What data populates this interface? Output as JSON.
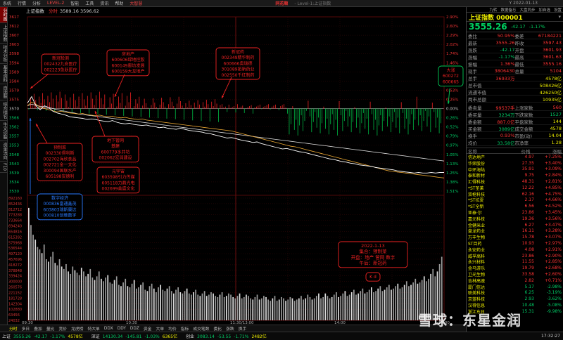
{
  "menubar": {
    "items": [
      "系统",
      "行情",
      "分析",
      "LEVEL-2",
      "智能",
      "工具",
      "资讯",
      "帮助",
      "大智慧"
    ],
    "logo": "同花顺",
    "level": "- Level-1:上证指数",
    "right": "Y 2022-01-13"
  },
  "leftbar": [
    "分时图",
    "上证指数",
    "技术分析",
    "基本资料",
    "自选股",
    "综合排名",
    "牛叉诊股",
    "资金流向",
    "F10"
  ],
  "chart": {
    "header_name": "上证指数",
    "header_freq": "分时",
    "header_vals": "3589.16  3596.62",
    "yaxis_left": [
      "3617",
      "3612",
      "3607",
      "3603",
      "3598",
      "3594",
      "3589",
      "3584",
      "3579",
      "3575",
      "3570",
      "3566",
      "3562",
      "3557",
      "3553",
      "3548",
      "3543",
      "3539",
      "3534",
      "3530"
    ],
    "yaxis_right": [
      "2.90%",
      "2.60%",
      "2.29%",
      "2.02%",
      "1.74%",
      "1.46%",
      "1.18%",
      "0.87%",
      "0.53%",
      "0.25%",
      "0.00%",
      "0.26%",
      "0.52%",
      "0.79%",
      "0.97%",
      "1.05%",
      "1.13%",
      "1.25%",
      "1.38%",
      "1.51%"
    ],
    "vol_axis": [
      "892160",
      "852436",
      "812712",
      "773288",
      "733664",
      "694240",
      "654816",
      "615392",
      "575968",
      "536544",
      "497120",
      "457696",
      "418272",
      "378848",
      "339424",
      "300000",
      "260576",
      "221152",
      "181728",
      "142304",
      "102880",
      "63456",
      "24032"
    ],
    "time_axis": [
      "09:30",
      "10:30",
      "11:30/13:00",
      "14:00",
      "15:00"
    ],
    "vol_values": [
      92,
      78,
      70,
      66,
      60,
      58,
      55,
      62,
      50,
      48,
      52,
      56,
      47,
      45,
      50,
      44,
      42,
      46,
      40,
      38,
      44,
      41,
      39,
      37,
      43,
      40,
      36,
      38,
      42,
      35,
      33,
      36,
      40,
      34,
      32,
      35,
      37,
      31,
      30,
      33,
      36,
      29,
      28,
      31,
      34,
      28,
      27,
      30,
      33,
      26,
      27,
      29,
      31,
      25,
      24,
      28,
      30,
      26,
      23,
      27,
      29,
      25,
      24,
      26,
      28,
      24,
      22,
      25,
      27,
      23,
      22,
      24,
      26,
      22,
      21,
      23,
      25,
      21,
      20,
      22,
      24,
      20,
      21,
      23,
      22,
      20,
      19,
      21,
      23,
      19,
      20,
      22,
      21,
      19,
      18,
      20,
      22,
      18,
      19,
      21,
      20,
      18,
      17,
      19,
      21,
      17,
      18,
      20,
      19,
      17,
      16,
      18,
      20,
      16,
      17,
      19,
      18,
      16,
      17,
      19,
      18,
      16,
      17,
      18,
      20,
      17,
      18,
      21,
      19,
      17,
      18,
      20,
      22,
      18,
      19,
      22,
      20,
      18,
      19,
      21,
      23,
      19,
      20,
      22,
      24,
      20,
      21,
      23,
      25,
      21,
      22,
      24,
      26,
      22,
      23,
      25,
      27,
      23,
      24,
      26,
      28,
      24,
      25,
      27,
      29,
      25,
      26,
      28,
      30,
      26,
      27,
      29,
      32,
      28,
      29,
      31,
      34,
      30,
      31,
      33,
      36,
      32,
      34,
      38,
      42,
      36,
      40,
      46,
      52
    ],
    "price_line": [
      0.1,
      0.22,
      0.05,
      -0.02,
      0.05,
      0.02,
      -0.05,
      -0.08,
      -0.1,
      -0.12,
      -0.15,
      -0.16,
      -0.17,
      -0.18,
      -0.2,
      -0.19,
      -0.2,
      -0.22,
      -0.23,
      -0.24,
      -0.22,
      -0.25,
      -0.27,
      -0.28,
      -0.27,
      -0.29,
      -0.3,
      -0.31,
      -0.3,
      -0.32,
      -0.33,
      -0.35,
      -0.34,
      -0.36,
      -0.37,
      -0.38,
      -0.36,
      -0.38,
      -0.4,
      -0.41,
      -0.42,
      -0.43,
      -0.45,
      -0.46,
      -0.48,
      -0.5,
      -0.52,
      -0.54,
      -0.53,
      -0.55,
      -0.57,
      -0.59,
      -0.6,
      -0.62,
      -0.61,
      -0.64,
      -0.66,
      -0.68,
      -0.7,
      -0.72,
      -0.74,
      -0.73,
      -0.75,
      -0.77,
      -0.79,
      -0.8,
      -0.82,
      -0.84,
      -0.86,
      -0.88,
      -0.9,
      -0.92,
      -0.93,
      -0.95,
      -0.97,
      -0.98,
      -1.0,
      -1.01,
      -1.03,
      -1.04,
      -1.05,
      -1.06,
      -1.08,
      -1.09,
      -1.1,
      -1.11,
      -1.12,
      -1.14,
      -1.15,
      -1.16,
      -1.17,
      -1.18,
      -1.17,
      -1.18,
      -1.18,
      -1.17,
      -1.18,
      -1.17,
      -1.17
    ],
    "avg_line": [
      0.05,
      0.08,
      0.06,
      0.04,
      0.03,
      0.02,
      0.0,
      -0.02,
      -0.04,
      -0.05,
      -0.07,
      -0.08,
      -0.1,
      -0.11,
      -0.12,
      -0.13,
      -0.14,
      -0.15,
      -0.16,
      -0.17,
      -0.18,
      -0.19,
      -0.2,
      -0.21,
      -0.22,
      -0.23,
      -0.24,
      -0.25,
      -0.26,
      -0.27,
      -0.28,
      -0.29,
      -0.3,
      -0.31,
      -0.32,
      -0.33,
      -0.34,
      -0.35,
      -0.36,
      -0.37,
      -0.38,
      -0.39,
      -0.4,
      -0.41,
      -0.42,
      -0.43,
      -0.44,
      -0.45,
      -0.46,
      -0.47,
      -0.48,
      -0.49,
      -0.5,
      -0.51,
      -0.52,
      -0.53,
      -0.54,
      -0.55,
      -0.56,
      -0.57,
      -0.58,
      -0.59,
      -0.6,
      -0.61,
      -0.62,
      -0.63,
      -0.64,
      -0.65,
      -0.66,
      -0.67,
      -0.68,
      -0.69,
      -0.7,
      -0.71,
      -0.72,
      -0.73,
      -0.74,
      -0.75,
      -0.76,
      -0.77,
      -0.78,
      -0.79,
      -0.8,
      -0.81,
      -0.82,
      -0.83,
      -0.84,
      -0.85,
      -0.86,
      -0.87,
      -0.88,
      -0.89,
      -0.9,
      -0.91,
      -0.92,
      -0.93,
      -0.94,
      -0.95,
      -0.96
    ],
    "yellow_line": [
      0.05,
      0.12,
      0.08,
      0.02,
      0.0,
      -0.02,
      -0.04,
      -0.06,
      -0.05,
      -0.07,
      -0.08,
      -0.09,
      -0.1,
      -0.09,
      -0.11,
      -0.12,
      -0.13,
      -0.12,
      -0.14,
      -0.15,
      -0.14,
      -0.16,
      -0.17,
      -0.16,
      -0.18,
      -0.19,
      -0.2,
      -0.19,
      -0.21,
      -0.22,
      -0.23,
      -0.24,
      -0.25,
      -0.26,
      -0.27,
      -0.28,
      -0.29,
      -0.3,
      -0.31,
      -0.32,
      -0.33,
      -0.34,
      -0.35,
      -0.36,
      -0.37,
      -0.38,
      -0.39,
      -0.4,
      -0.41,
      -0.43,
      -0.45,
      -0.47,
      -0.49,
      -0.51,
      -0.53,
      -0.55,
      -0.57,
      -0.59,
      -0.61,
      -0.63,
      -0.65,
      -0.67,
      -0.69,
      -0.7,
      -0.72,
      -0.74,
      -0.76,
      -0.78,
      -0.8,
      -0.82,
      -0.84,
      -0.86,
      -0.88,
      -0.9,
      -0.92,
      -0.94,
      -0.96,
      -0.98,
      -1.0,
      -1.02,
      -1.04,
      -1.06,
      -1.08,
      -1.1,
      -1.12,
      -1.14,
      -1.15,
      -1.16,
      -1.17,
      -1.18,
      -1.19,
      -1.2,
      -1.21,
      -1.22,
      -1.23,
      -1.24,
      -1.25,
      -1.26,
      -1.27
    ]
  },
  "annotations": [
    {
      "lines": [
        "新冠检测",
        "002432九安医疗",
        "002223鱼跃医疗"
      ]
    },
    {
      "lines": [
        "房地产",
        "600606绿地控股",
        "600149廊坊发展",
        "600159大龙地产"
      ]
    },
    {
      "lines": [
        "新冠药",
        "002349精华制药",
        "600666奥瑞德",
        "301089拓新药业",
        "002550千红制药"
      ]
    },
    {
      "lines": [
        "大涨",
        "600272",
        "600665"
      ]
    },
    {
      "lines": [
        "预制菜",
        "002330得利斯",
        "002702海欣食品",
        "002721金一文化",
        "300094国联水产",
        "605198安德利"
      ]
    },
    {
      "lines": [
        "地下管网",
        "基建",
        "600779水井坊",
        "002062宏润建设"
      ]
    },
    {
      "lines": [
        "元宇宙",
        "603598引力传媒",
        "605118力鼎光电",
        "002699美盛文化"
      ]
    },
    {
      "lines": [
        "数字经济",
        "000836富通鑫茂",
        "603803瑞斯康达",
        "000810创维数字"
      ]
    },
    {
      "lines": [
        "2022-1-13",
        "集合：预制菜",
        "开盘：地产 管网 数字",
        "午后：新冠药"
      ]
    },
    {
      "lines": [
        "K d"
      ]
    }
  ],
  "rpanel": {
    "tools": [
      "九转",
      "数据备忘",
      "大盘同步",
      "加自选",
      "设置"
    ],
    "title": "上证指数 000001",
    "price": "3555.26",
    "chg": "-42.17",
    "pct": "-1.17%",
    "quotes": [
      [
        "委比",
        "50.95%",
        "委差",
        "67184221"
      ],
      [
        "最新",
        "3555.26",
        "昨收",
        "3597.43"
      ],
      [
        "涨跌",
        "-42.17",
        "开盘",
        "3601.93"
      ],
      [
        "涨幅",
        "-1.17%",
        "最高",
        "3601.63"
      ],
      [
        "振幅",
        "1.36%",
        "最低",
        "3555.16"
      ],
      [
        "现手",
        "3806430",
        "总量",
        "5104"
      ],
      [
        "总手",
        "36933万",
        "",
        "4578亿"
      ],
      [
        "总市值",
        "",
        "",
        "508426亿"
      ],
      [
        "流通市值",
        "",
        "",
        "426250亿"
      ],
      [
        "两市总额",
        "",
        "",
        "10935亿"
      ]
    ],
    "flows": [
      [
        "委卖量",
        "99537手",
        "上涨家数",
        "560"
      ],
      [
        "委买量",
        "3234万",
        "下跌家数",
        "1527"
      ],
      [
        "委金额",
        "887.0亿",
        "平盘家数",
        "144"
      ],
      [
        "买金额",
        "3089亿",
        "成交金额",
        "4578"
      ],
      [
        "换手",
        "0.93%",
        "市盈(动)",
        "14.04"
      ],
      [
        "均价",
        "33.58亿",
        "市净率",
        "1.28"
      ]
    ],
    "list_head": [
      "名称",
      "价格",
      "涨幅"
    ],
    "stocks": [
      [
        "信达地产",
        "4.97",
        "+7.25%"
      ],
      [
        "华荣股份",
        "27.35",
        "+3.40%"
      ],
      [
        "中环海陆",
        "35.91",
        "+3.09%"
      ],
      [
        "泰和新材",
        "9.75",
        "+2.84%"
      ],
      [
        "汇得科技",
        "48.31",
        "+2.81%"
      ],
      [
        "*ST圣莱",
        "12.22",
        "+4.85%"
      ],
      [
        "双枪科技",
        "62.16",
        "+4.75%"
      ],
      [
        "*ST拉夏",
        "2.17",
        "+4.66%"
      ],
      [
        "*ST全新",
        "6.56",
        "+4.52%"
      ],
      [
        "亚泰·尔",
        "23.86",
        "+3.45%"
      ],
      [
        "嘉元科技",
        "19.36",
        "+3.56%"
      ],
      [
        "金健米业",
        "6.27",
        "+3.47%"
      ],
      [
        "盘龙药业",
        "16.11",
        "+3.28%"
      ],
      [
        "万丰生物",
        "15.78",
        "+3.07%"
      ],
      [
        "ST目药",
        "10.93",
        "+2.97%"
      ],
      [
        "永安药业",
        "4.08",
        "+2.91%"
      ],
      [
        "威孚高科",
        "23.86",
        "+2.90%"
      ],
      [
        "永兴材料",
        "11.55",
        "+2.85%"
      ],
      [
        "金马游乐",
        "19.79",
        "+2.68%"
      ],
      [
        "卫光生物",
        "33.58",
        "+2.60%"
      ],
      [
        "吉林高速",
        "2.82",
        "+0.71%"
      ],
      [
        "厦门信达",
        "5.17",
        "-2.98%"
      ],
      [
        "联美科技",
        "6.25",
        "-3.19%"
      ],
      [
        "京蓝科技",
        "2.93",
        "-3.62%"
      ],
      [
        "汉得信息",
        "10.48",
        "-5.08%"
      ],
      [
        "浙江东日",
        "15.31",
        "-9.98%"
      ]
    ]
  },
  "botbar": [
    "分时",
    "多日",
    "叠加",
    "量比",
    "竞价",
    "龙虎榜",
    "特大单",
    "DDX",
    "DDY",
    "DDZ",
    "资金",
    "大单",
    "均价",
    "指标",
    "成交笔数",
    "委比",
    "涨跌",
    "换手"
  ],
  "quotebar": {
    "items": [
      {
        "label": "上证",
        "val": "3555.26",
        "chg": "-42.17",
        "pct": "-1.17%",
        "amt": "4578亿"
      },
      {
        "label": "深证",
        "val": "14130.34",
        "chg": "-145.81",
        "pct": "-1.03%",
        "amt": "6365亿"
      },
      {
        "label": "创业",
        "val": "3083.14",
        "chg": "-53.55",
        "pct": "-1.71%",
        "amt": "2482亿"
      }
    ],
    "time": "17:32:27"
  },
  "watermark": "雪球：东星金润"
}
